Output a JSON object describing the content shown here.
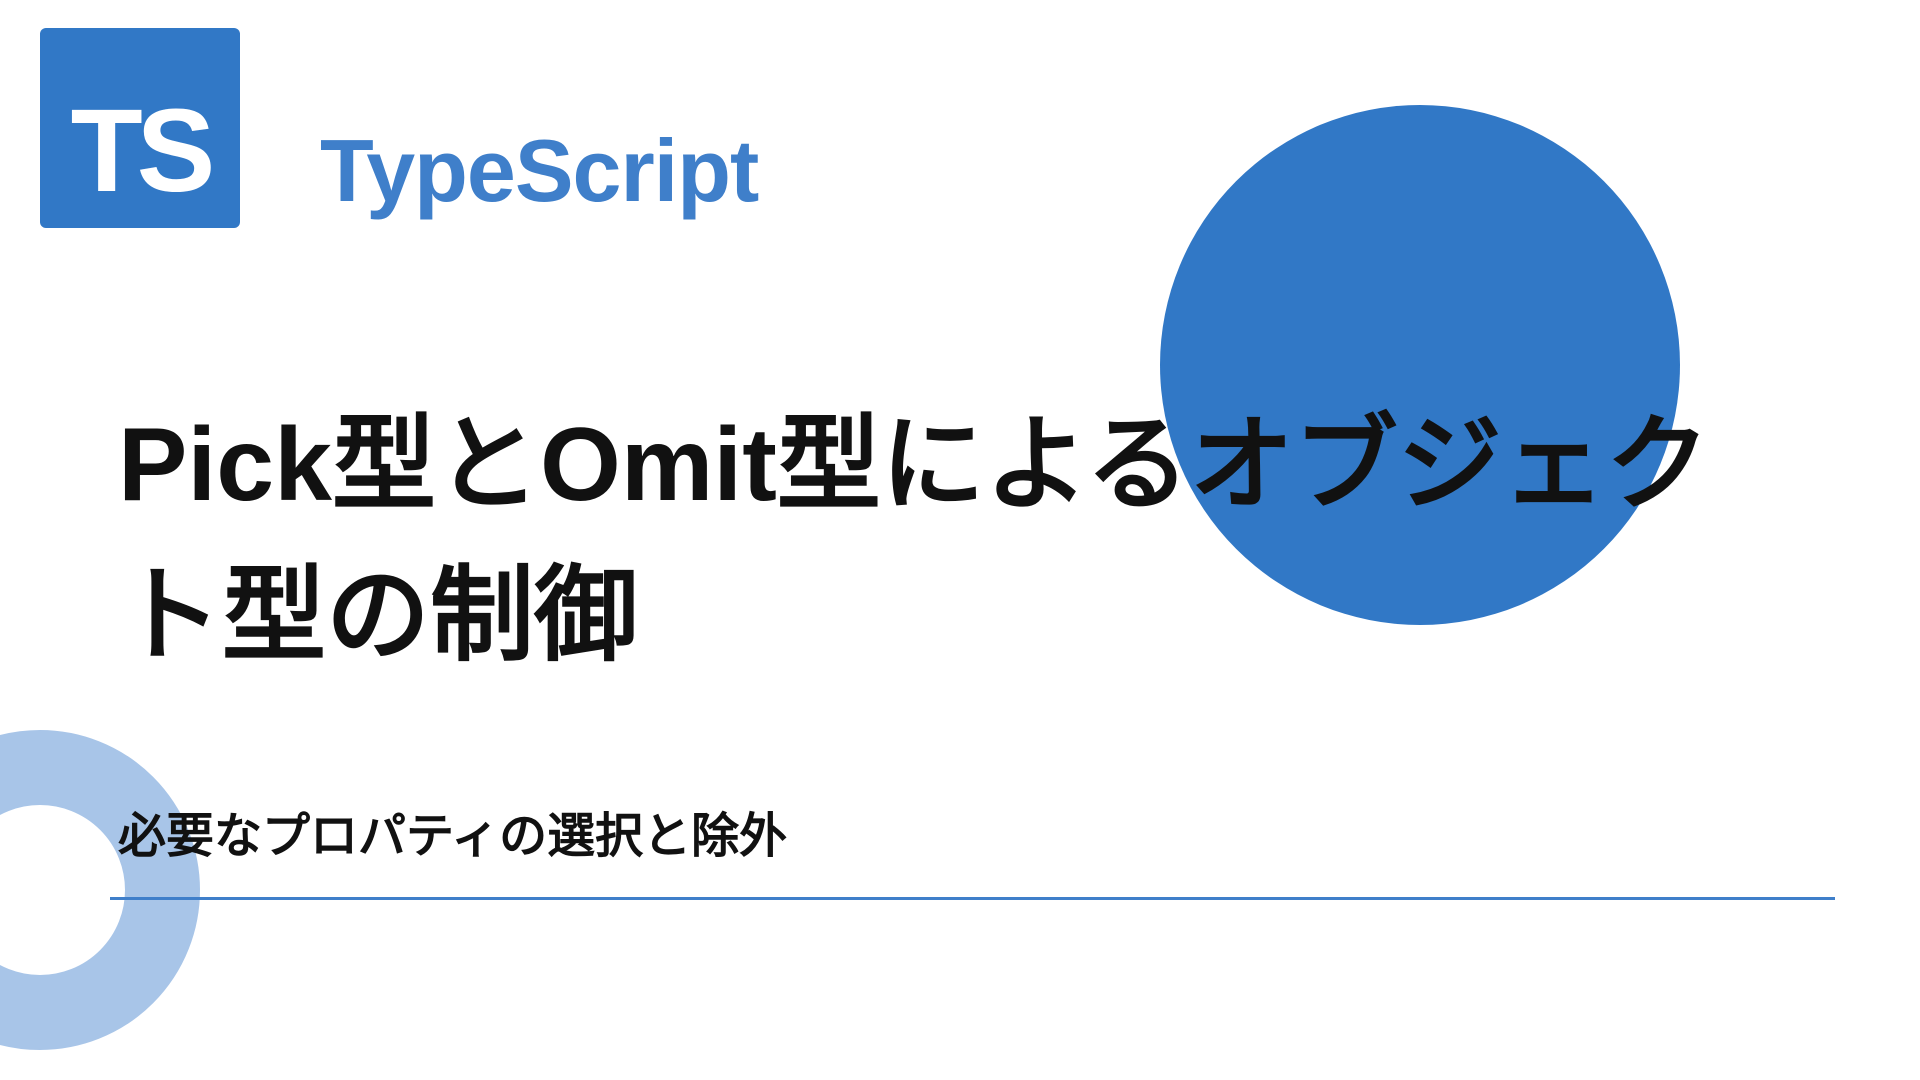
{
  "logo_text": "TS",
  "brand": "TypeScript",
  "title": "Pick型とOmit型によるオブジェクト型の制御",
  "subtitle": "必要なプロパティの選択と除外",
  "colors": {
    "primary": "#3178c6",
    "ring": "#a8c5e8",
    "underline": "#3f7fca"
  }
}
